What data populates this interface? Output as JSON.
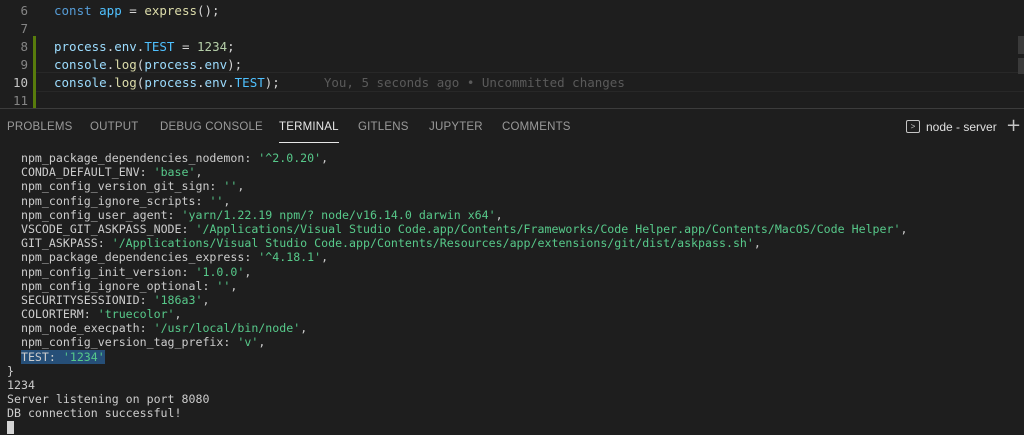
{
  "editor": {
    "lines": [
      {
        "n": "6",
        "parts": [
          [
            "kw",
            "const "
          ],
          [
            "const-c",
            "app"
          ],
          [
            "txt",
            " = "
          ],
          [
            "fn",
            "express"
          ],
          [
            "txt",
            "();"
          ]
        ]
      },
      {
        "n": "7",
        "parts": []
      },
      {
        "n": "8",
        "parts": [
          [
            "var",
            "process"
          ],
          [
            "txt",
            "."
          ],
          [
            "var",
            "env"
          ],
          [
            "txt",
            "."
          ],
          [
            "const-c",
            "TEST"
          ],
          [
            "txt",
            " = "
          ],
          [
            "num",
            "1234"
          ],
          [
            "txt",
            ";"
          ]
        ]
      },
      {
        "n": "9",
        "parts": [
          [
            "var",
            "console"
          ],
          [
            "txt",
            "."
          ],
          [
            "fn",
            "log"
          ],
          [
            "txt",
            "("
          ],
          [
            "var",
            "process"
          ],
          [
            "txt",
            "."
          ],
          [
            "var",
            "env"
          ],
          [
            "txt",
            ");"
          ]
        ]
      },
      {
        "n": "10",
        "parts": [
          [
            "var",
            "console"
          ],
          [
            "txt",
            "."
          ],
          [
            "fn",
            "log"
          ],
          [
            "txt",
            "("
          ],
          [
            "var",
            "process"
          ],
          [
            "txt",
            "."
          ],
          [
            "var",
            "env"
          ],
          [
            "txt",
            "."
          ],
          [
            "const-c",
            "TEST"
          ],
          [
            "txt",
            ");"
          ]
        ]
      },
      {
        "n": "11",
        "parts": []
      }
    ],
    "blame": "You, 5 seconds ago • Uncommitted changes"
  },
  "panel": {
    "tabs": [
      "PROBLEMS",
      "OUTPUT",
      "DEBUG CONSOLE",
      "TERMINAL",
      "GITLENS",
      "JUPYTER",
      "COMMENTS"
    ],
    "active_tab": "TERMINAL",
    "terminal_name": "node - server"
  },
  "terminal": {
    "env_lines": [
      {
        "key": "npm_package_dependencies_nodemon",
        "val": "'^2.0.20'"
      },
      {
        "key": "CONDA_DEFAULT_ENV",
        "val": "'base'"
      },
      {
        "key": "npm_config_version_git_sign",
        "val": "''"
      },
      {
        "key": "npm_config_ignore_scripts",
        "val": "''"
      },
      {
        "key": "npm_config_user_agent",
        "val": "'yarn/1.22.19 npm/? node/v16.14.0 darwin x64'"
      },
      {
        "key": "VSCODE_GIT_ASKPASS_NODE",
        "val": "'/Applications/Visual Studio Code.app/Contents/Frameworks/Code Helper.app/Contents/MacOS/Code Helper'"
      },
      {
        "key": "GIT_ASKPASS",
        "val": "'/Applications/Visual Studio Code.app/Contents/Resources/app/extensions/git/dist/askpass.sh'"
      },
      {
        "key": "npm_package_dependencies_express",
        "val": "'^4.18.1'"
      },
      {
        "key": "npm_config_init_version",
        "val": "'1.0.0'"
      },
      {
        "key": "npm_config_ignore_optional",
        "val": "''"
      },
      {
        "key": "SECURITYSESSIONID",
        "val": "'186a3'"
      },
      {
        "key": "COLORTERM",
        "val": "'truecolor'"
      },
      {
        "key": "npm_node_execpath",
        "val": "'/usr/local/bin/node'"
      },
      {
        "key": "npm_config_version_tag_prefix",
        "val": "'v'"
      }
    ],
    "highlight_line": {
      "key": "TEST",
      "val": "'1234'"
    },
    "close_brace": "}",
    "output": [
      "1234",
      "Server listening on port 8080",
      "DB connection successful!"
    ]
  },
  "colors": {
    "string": "#57c98a",
    "selection": "#264f78",
    "git_added": "#587c0c"
  }
}
